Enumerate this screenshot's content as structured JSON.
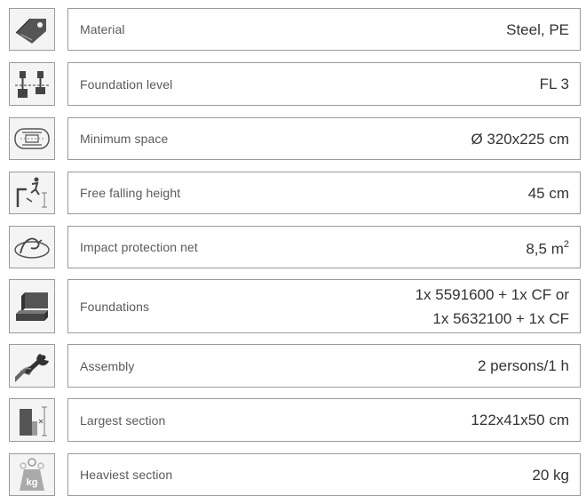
{
  "specs": [
    {
      "icon": "price-tag-icon",
      "label": "Material",
      "value": "Steel, PE"
    },
    {
      "icon": "foundation-level-icon",
      "label": "Foundation level",
      "value": "FL 3"
    },
    {
      "icon": "minimum-space-icon",
      "label": "Minimum space",
      "value": "Ø 320x225 cm"
    },
    {
      "icon": "falling-height-icon",
      "label": "Free falling height",
      "value": "45 cm"
    },
    {
      "icon": "impact-net-icon",
      "label": "Impact protection net",
      "value_main": "8,5 m",
      "value_sup": "2"
    },
    {
      "icon": "foundations-icon",
      "label": "Foundations",
      "value_line1": "1x 5591600 + 1x CF or",
      "value_line2": "1x 5632100 + 1x CF"
    },
    {
      "icon": "wrench-hand-icon",
      "label": "Assembly",
      "value": "2 persons/1 h"
    },
    {
      "icon": "largest-section-icon",
      "label": "Largest section",
      "value": "122x41x50 cm"
    },
    {
      "icon": "weight-kg-icon",
      "label": "Heaviest section",
      "value": "20 kg",
      "icon_text": "kg"
    }
  ]
}
